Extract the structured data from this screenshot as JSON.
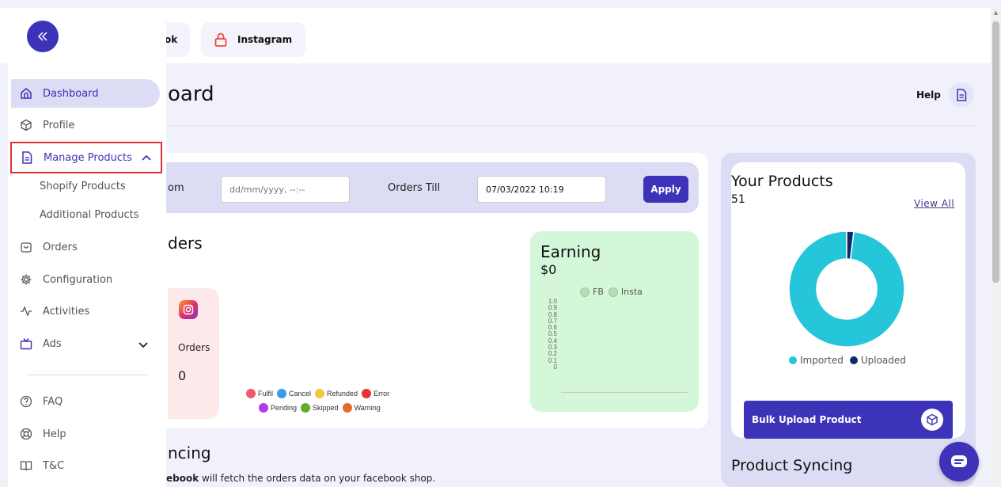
{
  "tabs": {
    "facebook_label": "ok",
    "instagram_label": "Instagram"
  },
  "header": {
    "title": "oard",
    "help_label": "Help"
  },
  "filters": {
    "from_label": "om",
    "from_placeholder": "dd/mm/yyyy, --:--",
    "till_label": "Orders Till",
    "till_value": "07/03/2022 10:19",
    "apply_label": "Apply"
  },
  "orders": {
    "title": "ders",
    "instagram_orders_label": "Orders",
    "instagram_orders_value": "0",
    "legend": [
      {
        "label": "Fulfil",
        "color": "#f0566e"
      },
      {
        "label": "Cancel",
        "color": "#3a9be8"
      },
      {
        "label": "Refunded",
        "color": "#f7c440"
      },
      {
        "label": "Error",
        "color": "#e8332f"
      },
      {
        "label": "Pending",
        "color": "#b23be6"
      },
      {
        "label": "Skipped",
        "color": "#5fae2d"
      },
      {
        "label": "Warning",
        "color": "#de6c2a"
      }
    ]
  },
  "earning": {
    "title": "Earning",
    "value": "$0",
    "legend_fb": "FB",
    "legend_insta": "Insta",
    "y_ticks": [
      "1.0",
      "0.9",
      "0.8",
      "0.7",
      "0.6",
      "0.5",
      "0.4",
      "0.3",
      "0.2",
      "0.1",
      "0"
    ]
  },
  "syncing": {
    "title": "ncing",
    "desc_bold": "ebook",
    "desc_rest": " will fetch the orders data on your facebook shop."
  },
  "products": {
    "title": "Your Products",
    "count": "51",
    "view_all": "View All",
    "legend_imported": "Imported",
    "legend_uploaded": "Uploaded",
    "imported_color": "#26c6da",
    "uploaded_color": "#0d2a6b",
    "bulk_label": "Bulk Upload Product",
    "syncing_title": "Product Syncing"
  },
  "chart_data": {
    "type": "pie",
    "categories": [
      "Imported",
      "Uploaded"
    ],
    "values": [
      50,
      1
    ],
    "title": "",
    "legend": "bottom"
  },
  "sidebar": {
    "items": [
      {
        "label": "Dashboard"
      },
      {
        "label": "Profile"
      },
      {
        "label": "Manage Products"
      },
      {
        "label": "Orders"
      },
      {
        "label": "Configuration"
      },
      {
        "label": "Activities"
      },
      {
        "label": "Ads"
      },
      {
        "label": "FAQ"
      },
      {
        "label": "Help"
      },
      {
        "label": "T&C"
      }
    ],
    "sub_items": [
      {
        "label": "Shopify Products"
      },
      {
        "label": "Additional Products"
      }
    ]
  }
}
